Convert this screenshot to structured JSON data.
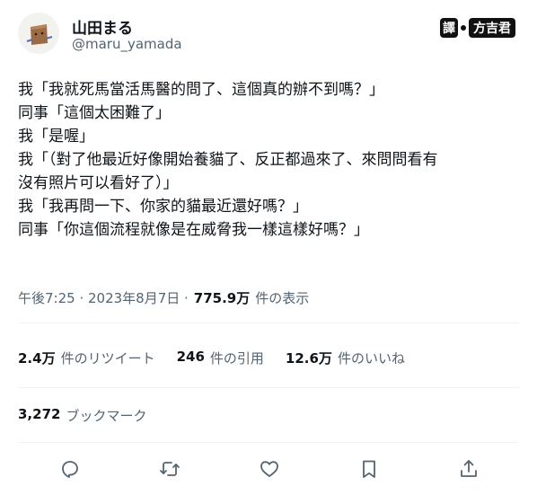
{
  "author": {
    "display_name": "山田まる",
    "handle": "@maru_yamada"
  },
  "translator_badge": {
    "label": "譯",
    "name": "方吉君"
  },
  "tweet": {
    "lines": [
      "我「我就死馬當活馬醫的問了、這個真的辦不到嗎？」",
      "同事「這個太困難了」",
      "我「是喔」",
      "我「（對了他最近好像開始養貓了、反正都過來了、來問問看有",
      "沒有照片可以看好了）」",
      "我「我再問一下、你家的貓最近還好嗎？」",
      "同事「你這個流程就像是在威脅我一樣這樣好嗎？」"
    ]
  },
  "meta": {
    "timestamp": "午後7:25 · 2023年8月7日 ·",
    "views_count": "775.9万",
    "views_label": "件の表示"
  },
  "stats": {
    "retweets_count": "2.4万",
    "retweets_label": "件のリツイート",
    "quotes_count": "246",
    "quotes_label": "件の引用",
    "likes_count": "12.6万",
    "likes_label": "件のいいね"
  },
  "bookmarks": {
    "count": "3,272",
    "label": "ブックマーク"
  },
  "icons": {
    "reply": "reply-icon",
    "retweet": "retweet-icon",
    "like": "heart-icon",
    "bookmark": "bookmark-icon",
    "share": "share-icon"
  },
  "colors": {
    "text": "#0f1419",
    "secondary": "#536471",
    "divider": "#eff3f4"
  }
}
